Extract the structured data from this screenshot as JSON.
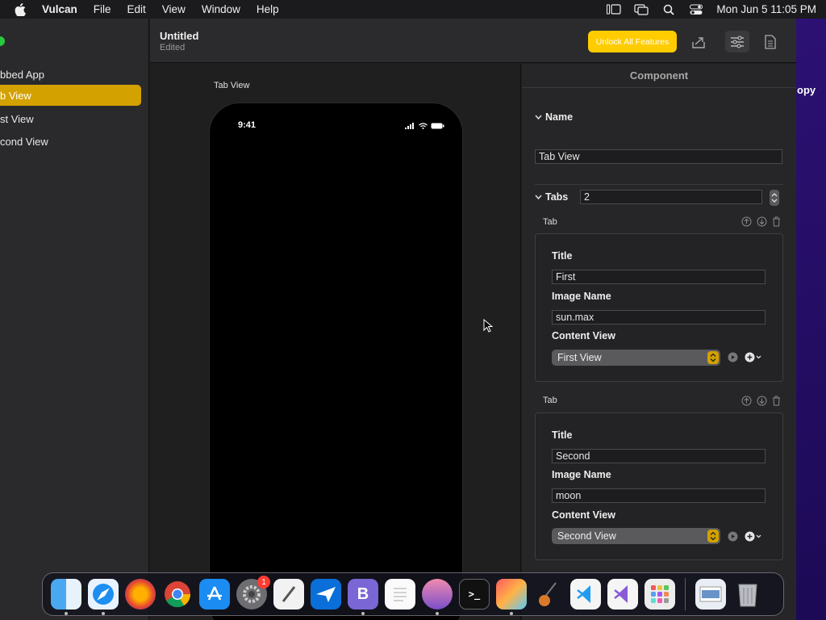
{
  "menubar": {
    "app_name": "Vulcan",
    "items": [
      "File",
      "Edit",
      "View",
      "Window",
      "Help"
    ],
    "clock": "Mon Jun 5  11:05 PM"
  },
  "sidebar": {
    "items": [
      {
        "label": "bbed App"
      },
      {
        "label": "b View"
      },
      {
        "label": "st View"
      },
      {
        "label": "cond View"
      }
    ]
  },
  "toolbar": {
    "title": "Untitled",
    "subtitle": "Edited",
    "unlock_label": "Unlock All Features"
  },
  "canvas": {
    "label": "Tab View",
    "phone_time": "9:41"
  },
  "inspector": {
    "header": "Component",
    "name_section": "Name",
    "name_value": "Tab View",
    "tabs_section": "Tabs",
    "tabs_count": "2",
    "tabs": [
      {
        "caption": "Tab",
        "title_label": "Title",
        "title_value": "First",
        "image_label": "Image Name",
        "image_value": "sun.max",
        "content_label": "Content View",
        "content_value": "First View"
      },
      {
        "caption": "Tab",
        "title_label": "Title",
        "title_value": "Second",
        "image_label": "Image Name",
        "image_value": "moon",
        "content_label": "Content View",
        "content_value": "Second View"
      }
    ]
  },
  "background_text": "opy",
  "dock": {
    "settings_badge": "1",
    "apps": [
      "finder",
      "safari",
      "firefox",
      "chrome",
      "app-store",
      "system-settings",
      "script-editor",
      "mail-plane",
      "bbedit",
      "textedit",
      "sunset-app",
      "terminal",
      "photo-app",
      "instruments",
      "vscode",
      "visual-studio",
      "launchpad",
      "preview",
      "trash"
    ]
  },
  "colors": {
    "accent": "#d3a100",
    "unlock_button": "#ffcc00",
    "menubar": "#1b1b1d",
    "desktop": "#2a1070"
  }
}
